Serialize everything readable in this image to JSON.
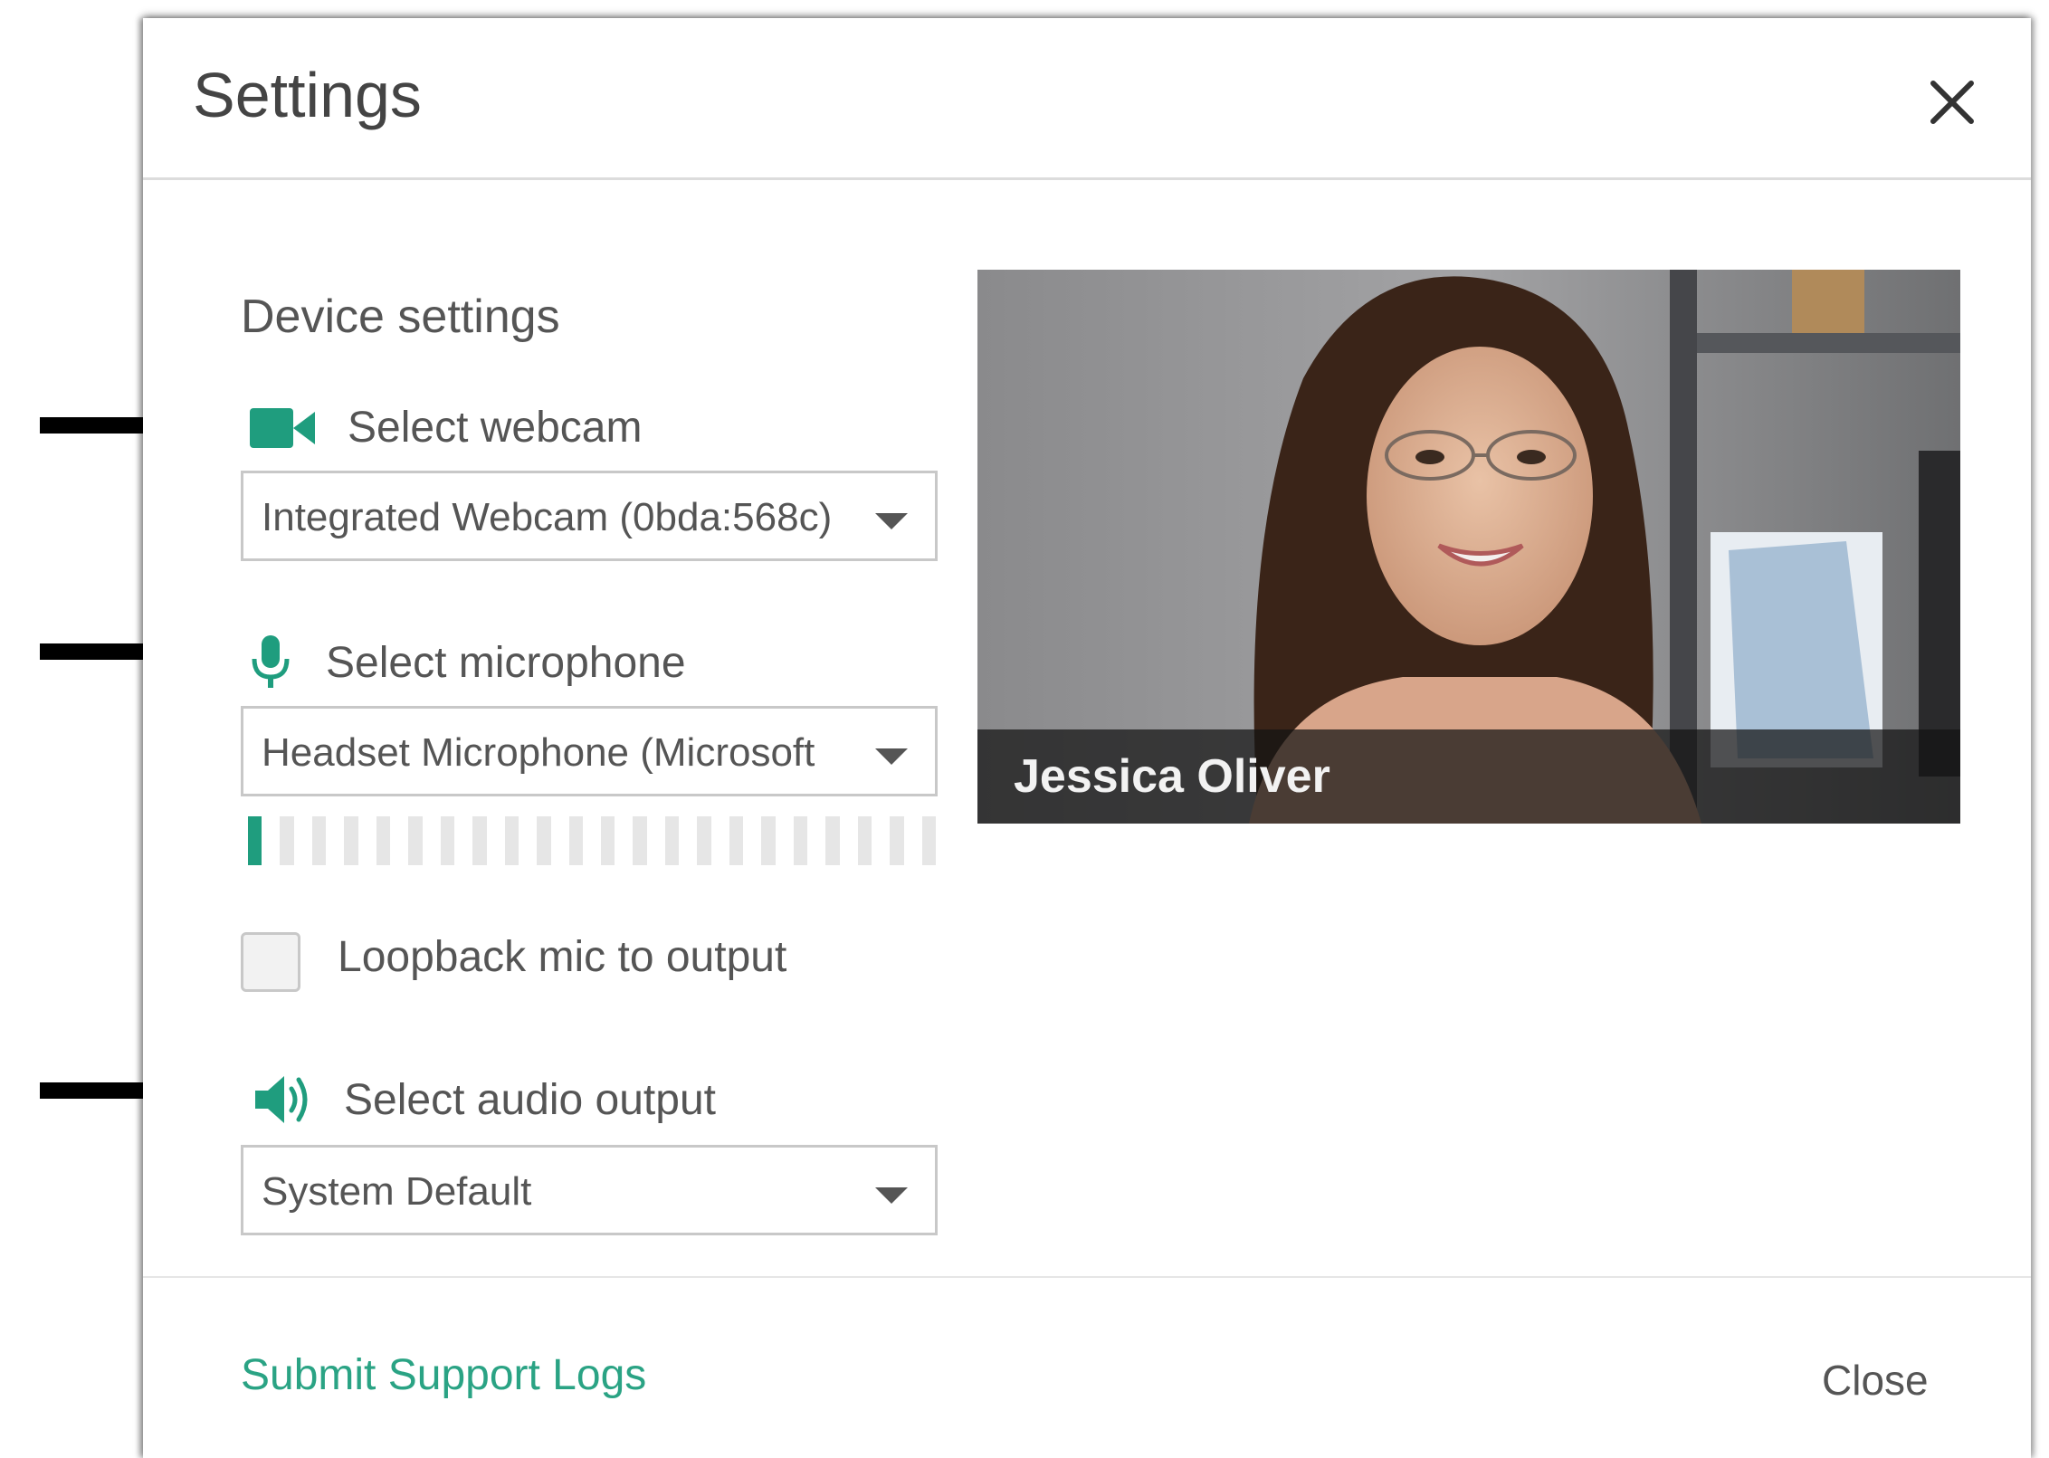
{
  "dialog": {
    "title": "Settings"
  },
  "device_settings": {
    "heading": "Device settings",
    "webcam": {
      "label": "Select webcam",
      "icon": "video-camera-icon",
      "value": "Integrated Webcam (0bda:568c)"
    },
    "microphone": {
      "label": "Select microphone",
      "icon": "microphone-icon",
      "value": "Headset Microphone (Microsoft",
      "level_bars_total": 22,
      "level_bars_active": 1
    },
    "loopback": {
      "label": "Loopback mic to output",
      "checked": false
    },
    "audio_output": {
      "label": "Select audio output",
      "icon": "speaker-icon",
      "value": "System Default"
    }
  },
  "preview": {
    "participant_name": "Jessica Oliver"
  },
  "footer": {
    "support_link": "Submit Support Logs",
    "close_label": "Close"
  },
  "colors": {
    "accent": "#1f9d7e",
    "link": "#2aa384",
    "text": "#555555",
    "border": "#c8c8c8"
  }
}
